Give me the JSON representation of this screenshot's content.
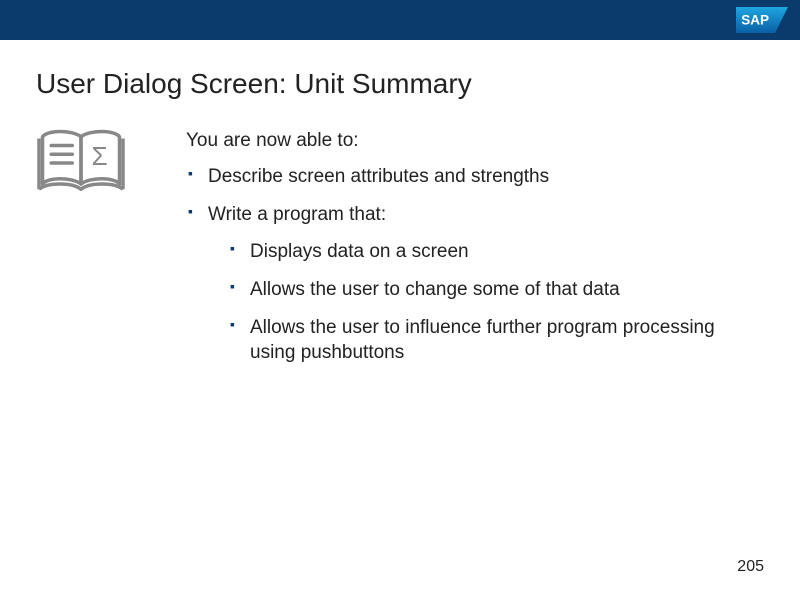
{
  "header": {
    "logo_text": "SAP"
  },
  "title": "User Dialog Screen: Unit Summary",
  "intro": "You are now able to:",
  "bullets": [
    {
      "text": "Describe screen attributes and strengths"
    },
    {
      "text": "Write a program that:",
      "children": [
        "Displays data on a screen",
        "Allows the user to change some of that data",
        "Allows the user to influence further program processing using pushbuttons"
      ]
    }
  ],
  "page_number": "205"
}
